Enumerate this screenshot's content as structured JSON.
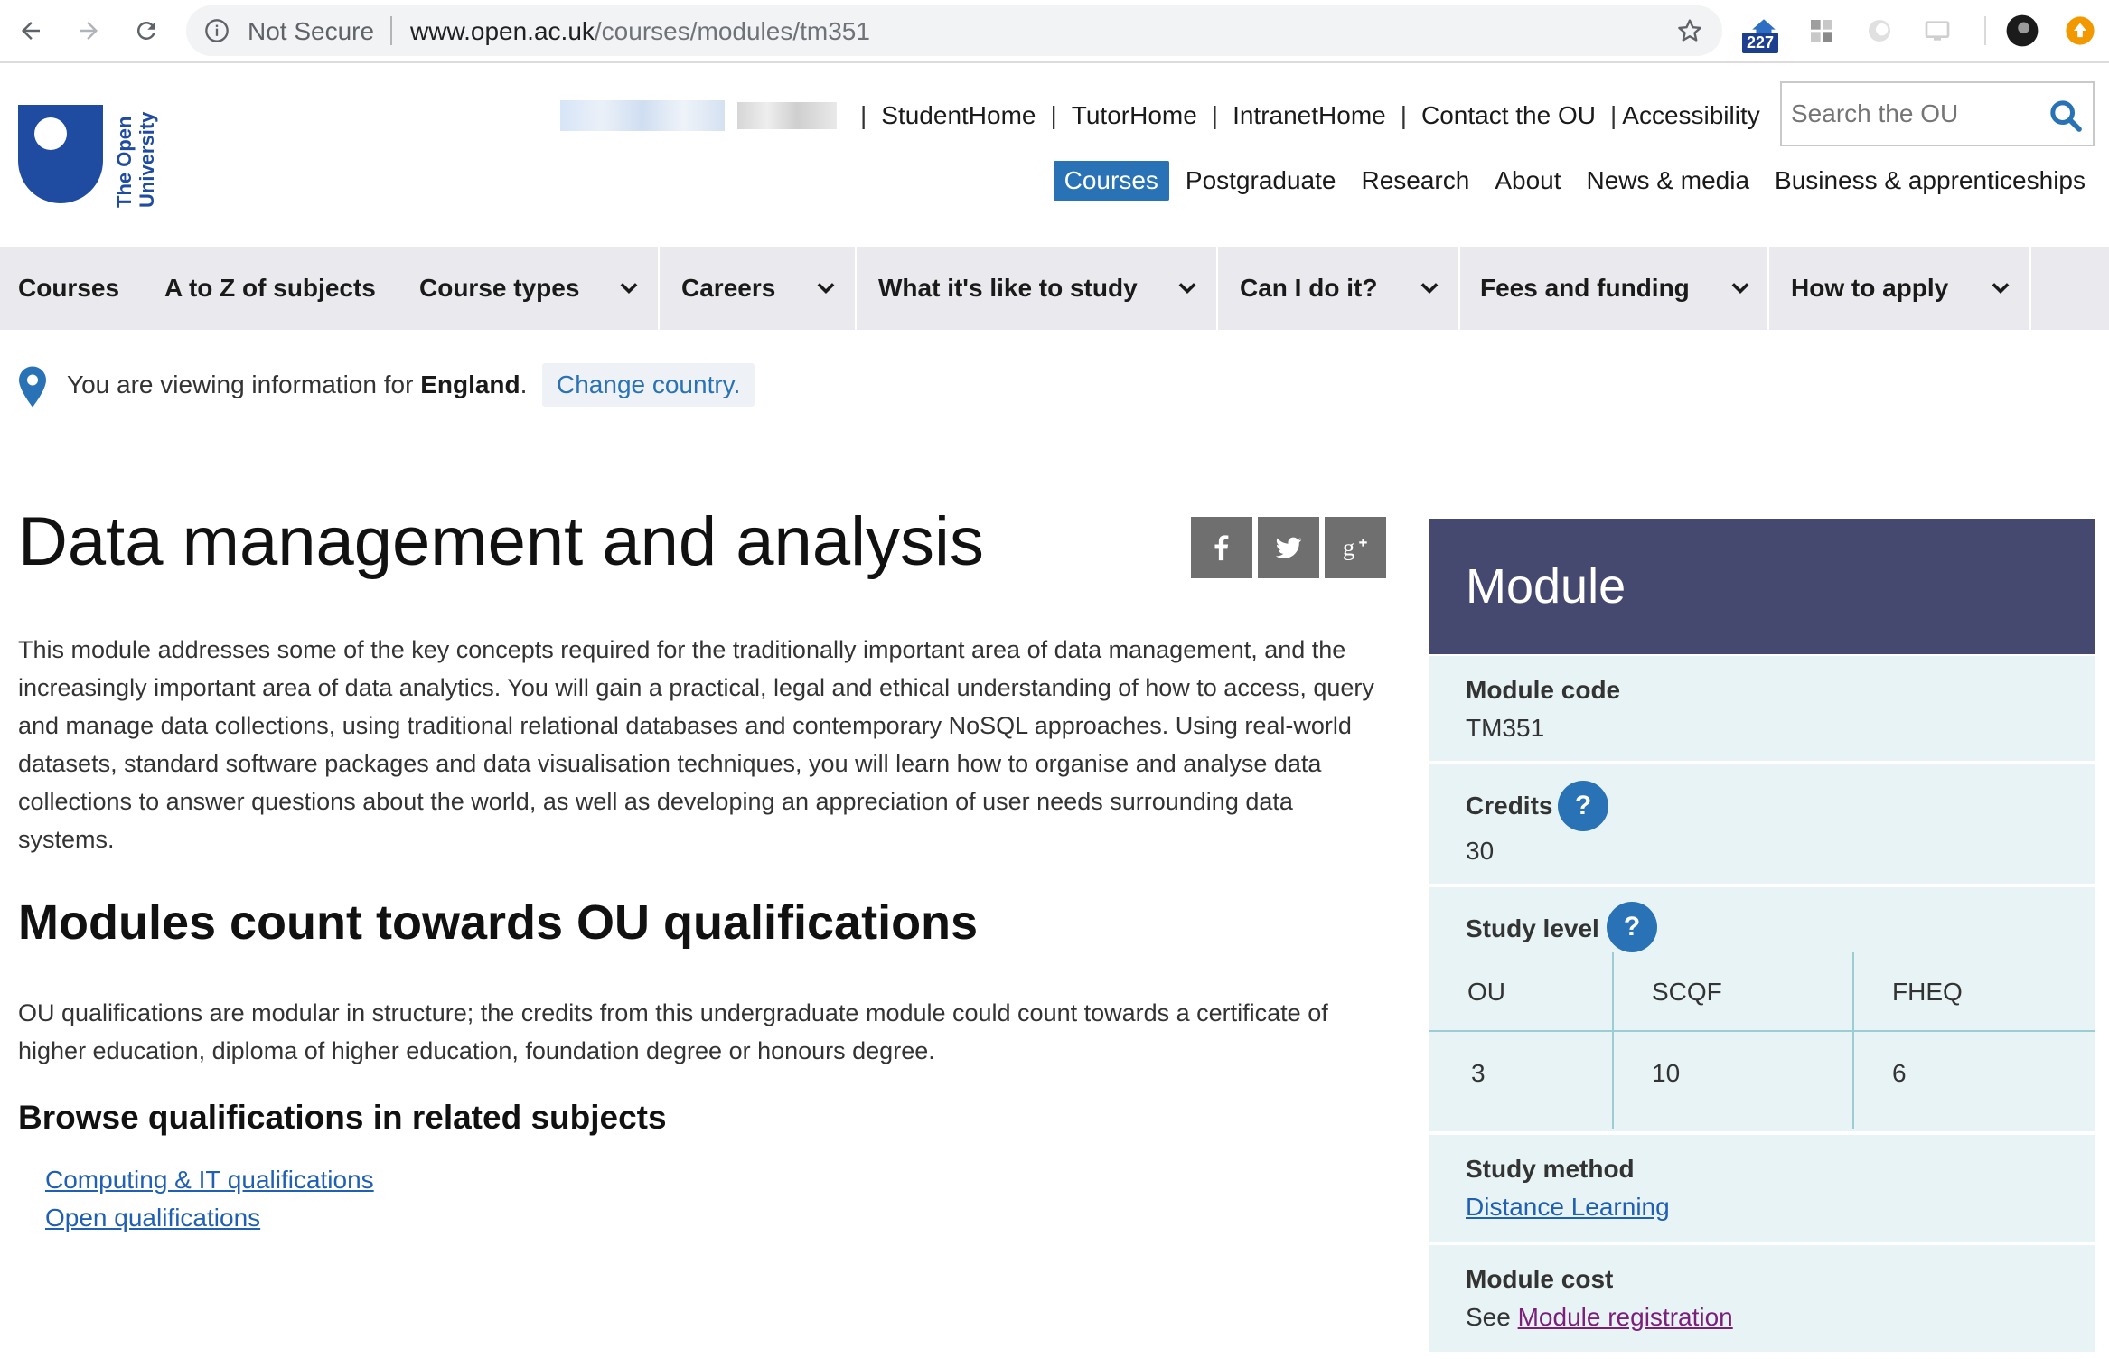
{
  "browser": {
    "security_label": "Not Secure",
    "url_host": "www.open.ac.uk",
    "url_path": "/courses/modules/tm351",
    "extension_badge": "227"
  },
  "header": {
    "logo_text_line1": "The Open",
    "logo_text_line2": "University",
    "util_links": [
      "StudentHome",
      "TutorHome",
      "IntranetHome",
      "Contact the OU",
      "Accessibility"
    ],
    "search_placeholder": "Search the OU",
    "main_nav": [
      "Courses",
      "Postgraduate",
      "Research",
      "About",
      "News & media",
      "Business & apprenticeships"
    ]
  },
  "subnav": {
    "items": [
      "Courses",
      "A to Z of subjects",
      "Course types",
      "Careers",
      "What it's like to study",
      "Can I do it?",
      "Fees and funding",
      "How to apply"
    ]
  },
  "country": {
    "prefix": "You are viewing information for ",
    "country": "England",
    "suffix": ".",
    "change_label": "Change country."
  },
  "main": {
    "title": "Data management and analysis",
    "intro": "This module addresses some of the key concepts required for the traditionally important area of data management, and the increasingly important area of data analytics. You will gain a practical, legal and ethical understanding of how to access, query and manage data collections, using traditional relational databases and contemporary NoSQL approaches. Using real-world datasets, standard software packages and data visualisation techniques, you will learn how to organise and analyse data collections to answer questions about the world, as well as developing an appreciation of user needs surrounding data systems.",
    "qual_heading": "Modules count towards OU qualifications",
    "qual_text": "OU qualifications are modular in structure; the credits from this undergraduate module could count towards a certificate of higher education, diploma of higher education, foundation degree or honours degree.",
    "related_heading": "Browse qualifications in related subjects",
    "related_links": [
      "Computing & IT qualifications",
      "Open qualifications"
    ]
  },
  "sidebar": {
    "heading": "Module",
    "code_label": "Module code",
    "code_value": "TM351",
    "credits_label": "Credits",
    "credits_value": "30",
    "level_label": "Study level",
    "help_glyph": "?",
    "level_columns": [
      "OU",
      "SCQF",
      "FHEQ"
    ],
    "level_values": [
      "3",
      "10",
      "6"
    ],
    "method_label": "Study method",
    "method_value": "Distance Learning",
    "cost_label": "Module cost",
    "cost_prefix": "See ",
    "cost_link": "Module registration"
  },
  "colors": {
    "brand_blue": "#2872b5",
    "sidebar_header": "#46496f",
    "sidebar_panel": "#e7f3f4",
    "subnav_bg": "#e9e9ee"
  }
}
